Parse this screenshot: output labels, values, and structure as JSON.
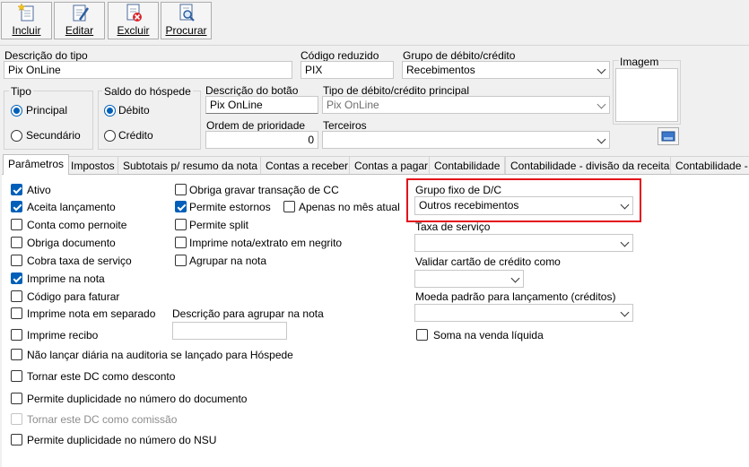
{
  "toolbar": {
    "incluir": "Incluir",
    "editar": "Editar",
    "excluir": "Excluir",
    "procurar": "Procurar"
  },
  "form": {
    "descricao_tipo_label": "Descrição do tipo",
    "descricao_tipo_value": "Pix OnLine",
    "codigo_reduzido_label": "Código reduzido",
    "codigo_reduzido_value": "PIX",
    "grupo_label": "Grupo de débito/crédito",
    "grupo_value": "Recebimentos",
    "imagem_label": "Imagem",
    "tipo_label": "Tipo",
    "tipo_principal": "Principal",
    "tipo_secundario": "Secundário",
    "saldo_label": "Saldo do hóspede",
    "saldo_debito": "Débito",
    "saldo_credito": "Crédito",
    "descricao_botao_label": "Descrição do botão",
    "descricao_botao_value": "Pix OnLine",
    "tipo_dc_label": "Tipo de débito/crédito principal",
    "tipo_dc_value": "Pix OnLine",
    "ordem_label": "Ordem de prioridade",
    "ordem_value": "0",
    "terceiros_label": "Terceiros",
    "terceiros_value": ""
  },
  "tabs": [
    "Parâmetros",
    "Impostos",
    "Subtotais p/ resumo da nota",
    "Contas a receber",
    "Contas a pagar",
    "Contabilidade",
    "Contabilidade - divisão da receita",
    "Contabilidade -"
  ],
  "checkboxes_col1": [
    {
      "label": "Ativo",
      "checked": true
    },
    {
      "label": "Aceita lançamento",
      "checked": true
    },
    {
      "label": "Conta como pernoite",
      "checked": false
    },
    {
      "label": "Obriga documento",
      "checked": false
    },
    {
      "label": "Cobra taxa de serviço",
      "checked": false
    },
    {
      "label": "Imprime na nota",
      "checked": true
    },
    {
      "label": "Código para faturar",
      "checked": false
    },
    {
      "label": "Imprime nota em separado",
      "checked": false
    },
    {
      "label": "Imprime recibo",
      "checked": false
    },
    {
      "label": "Não lançar diária na auditoria se lançado para Hóspede",
      "checked": false
    },
    {
      "label": "Tornar este DC como desconto",
      "checked": false
    },
    {
      "label": "Permite duplicidade no número do documento",
      "checked": false
    },
    {
      "label": "Tornar este DC como comissão",
      "checked": false,
      "disabled": true
    },
    {
      "label": "Permite duplicidade no número do NSU",
      "checked": false
    }
  ],
  "checkboxes_col2": [
    {
      "label": "Obriga gravar transação de CC",
      "checked": false
    },
    {
      "label": "Permite estornos",
      "checked": true
    },
    {
      "label": "Apenas no mês atual",
      "checked": false
    },
    {
      "label": "Permite split",
      "checked": false
    },
    {
      "label": "Imprime nota/extrato em negrito",
      "checked": false
    },
    {
      "label": "Agrupar na nota",
      "checked": false
    }
  ],
  "descricao_agrupar_label": "Descrição para agrupar na nota",
  "descricao_agrupar_value": "",
  "right": {
    "grupo_fixo_label": "Grupo fixo de D/C",
    "grupo_fixo_value": "Outros recebimentos",
    "taxa_servico_label": "Taxa de serviço",
    "taxa_servico_value": "",
    "validar_cartao_label": "Validar cartão de crédito como",
    "validar_cartao_value": "",
    "moeda_label": "Moeda padrão para lançamento (créditos)",
    "moeda_value": "",
    "soma_venda": "Soma na venda líquida"
  },
  "colors": {
    "accent": "#005fb8",
    "highlight_border": "#e3101a"
  }
}
